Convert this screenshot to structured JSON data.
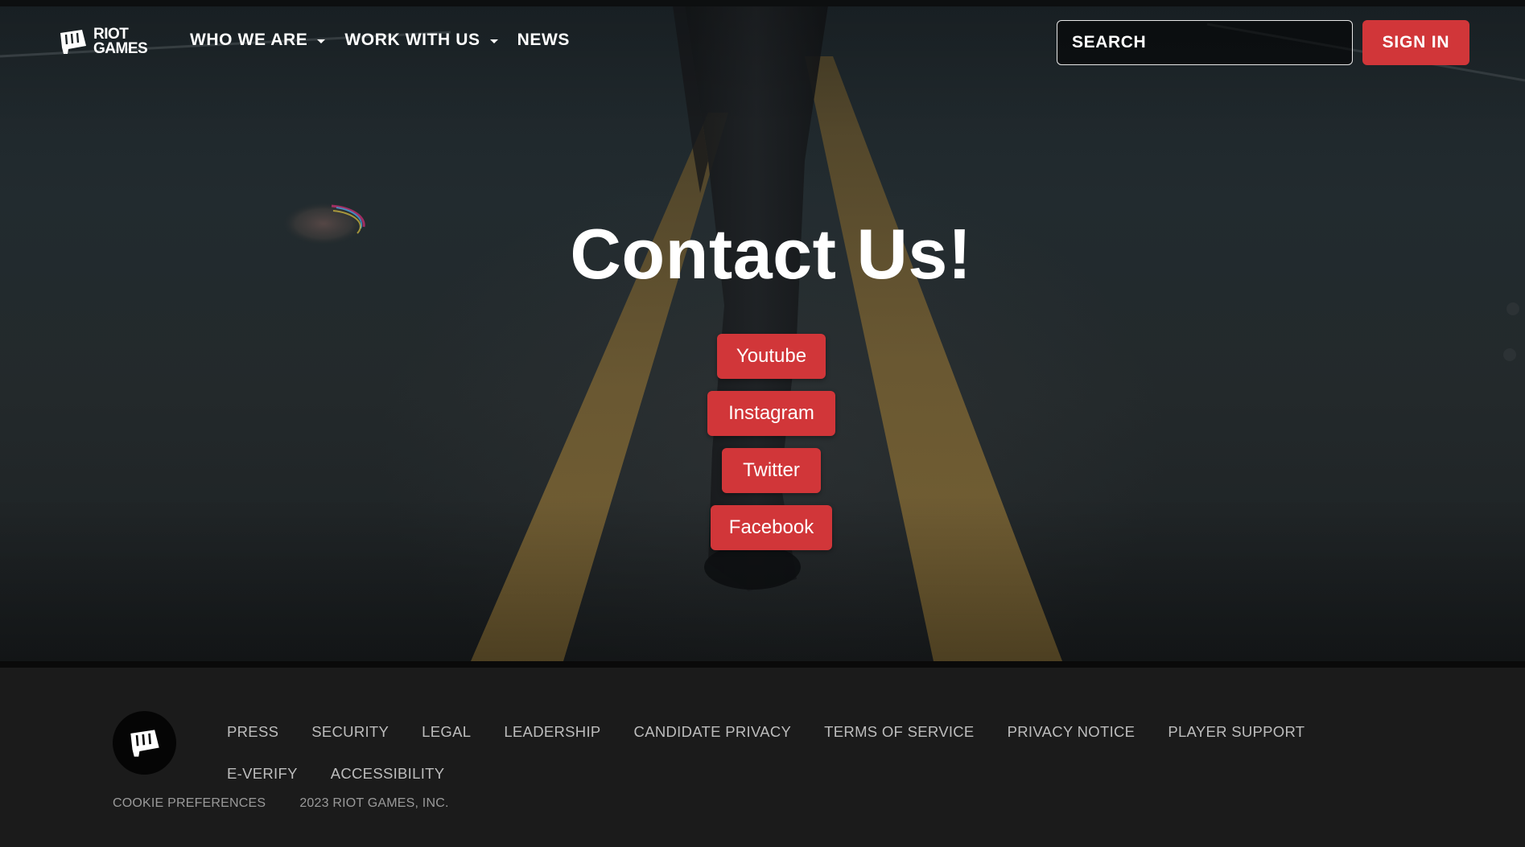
{
  "brand": {
    "logo_text_line1": "RIOT",
    "logo_text_line2": "GAMES"
  },
  "nav": {
    "items": [
      {
        "label": "WHO WE ARE",
        "has_dropdown": true
      },
      {
        "label": "WORK WITH US",
        "has_dropdown": true
      },
      {
        "label": "NEWS",
        "has_dropdown": false
      }
    ],
    "search_placeholder": "SEARCH",
    "sign_in_label": "SIGN IN"
  },
  "hero": {
    "title": "Contact Us!",
    "buttons": [
      {
        "label": "Youtube"
      },
      {
        "label": "Instagram"
      },
      {
        "label": "Twitter"
      },
      {
        "label": "Facebook"
      }
    ]
  },
  "footer": {
    "links_row1": [
      "PRESS",
      "SECURITY",
      "LEGAL",
      "LEADERSHIP",
      "CANDIDATE PRIVACY",
      "TERMS OF SERVICE",
      "PRIVACY NOTICE",
      "PLAYER SUPPORT"
    ],
    "links_row2": [
      "E-VERIFY",
      "ACCESSIBILITY"
    ],
    "cookie_preferences": "COOKIE PREFERENCES",
    "copyright": "2023 RIOT GAMES, INC."
  },
  "colors": {
    "accent_red": "#d13639",
    "footer_bg": "#1b1b1b",
    "footer_link": "#bdbdbd",
    "road_line": "#7a6434"
  }
}
